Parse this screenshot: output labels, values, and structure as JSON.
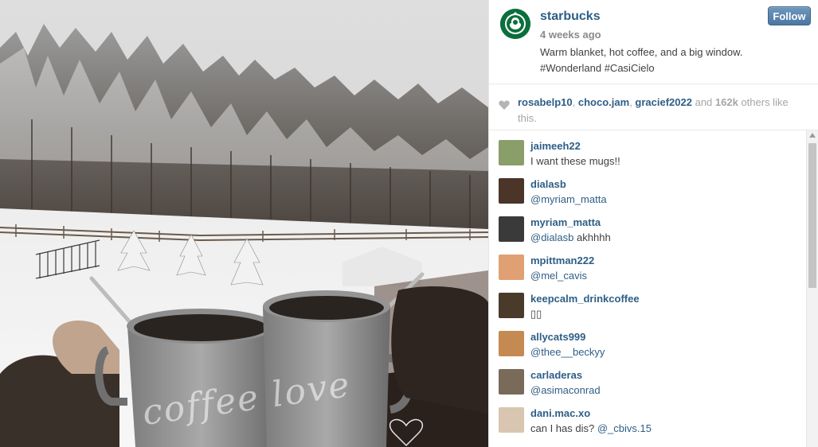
{
  "post": {
    "username": "starbucks",
    "time_ago": "4 weeks ago",
    "caption": "Warm blanket, hot coffee, and a big window. #Wonderland #CasiCielo",
    "follow_label": "Follow",
    "photo_text": "coffee love"
  },
  "likes": {
    "users": [
      "rosabelp10",
      "choco.jam",
      "gracief2022"
    ],
    "sep1": ", ",
    "sep2": ", ",
    "and_text": " and ",
    "count": "162k",
    "suffix": " others like this."
  },
  "comments": [
    {
      "user": "jaimeeh22",
      "text": "I want these mugs!!",
      "mention": "",
      "avatar_color": "#8a9e6a"
    },
    {
      "user": "dialasb",
      "text": "",
      "mention": "@myriam_matta",
      "avatar_color": "#4a3528"
    },
    {
      "user": "myriam_matta",
      "text": " akhhhh",
      "mention": "@dialasb",
      "avatar_color": "#3a3a3a"
    },
    {
      "user": "mpittman222",
      "text": "",
      "mention": "@mel_cavis",
      "avatar_color": "#e0a073"
    },
    {
      "user": "keepcalm_drinkcoffee",
      "text": "▯▯",
      "mention": "",
      "avatar_color": "#4a3a2a"
    },
    {
      "user": "allycats999",
      "text": "",
      "mention": "@thee__beckyy",
      "avatar_color": "#c58a52"
    },
    {
      "user": "carladeras",
      "text": "",
      "mention": "@asimaconrad",
      "avatar_color": "#7a6a5a"
    },
    {
      "user": "dani.mac.xo",
      "text": "can I has dis? ",
      "mention": "@_cbivs.15",
      "avatar_color": "#d8c6b0"
    }
  ],
  "colors": {
    "link": "#2e5e86",
    "follow_bg": "#4b77a1",
    "starbucks_green": "#0b6f3d"
  }
}
